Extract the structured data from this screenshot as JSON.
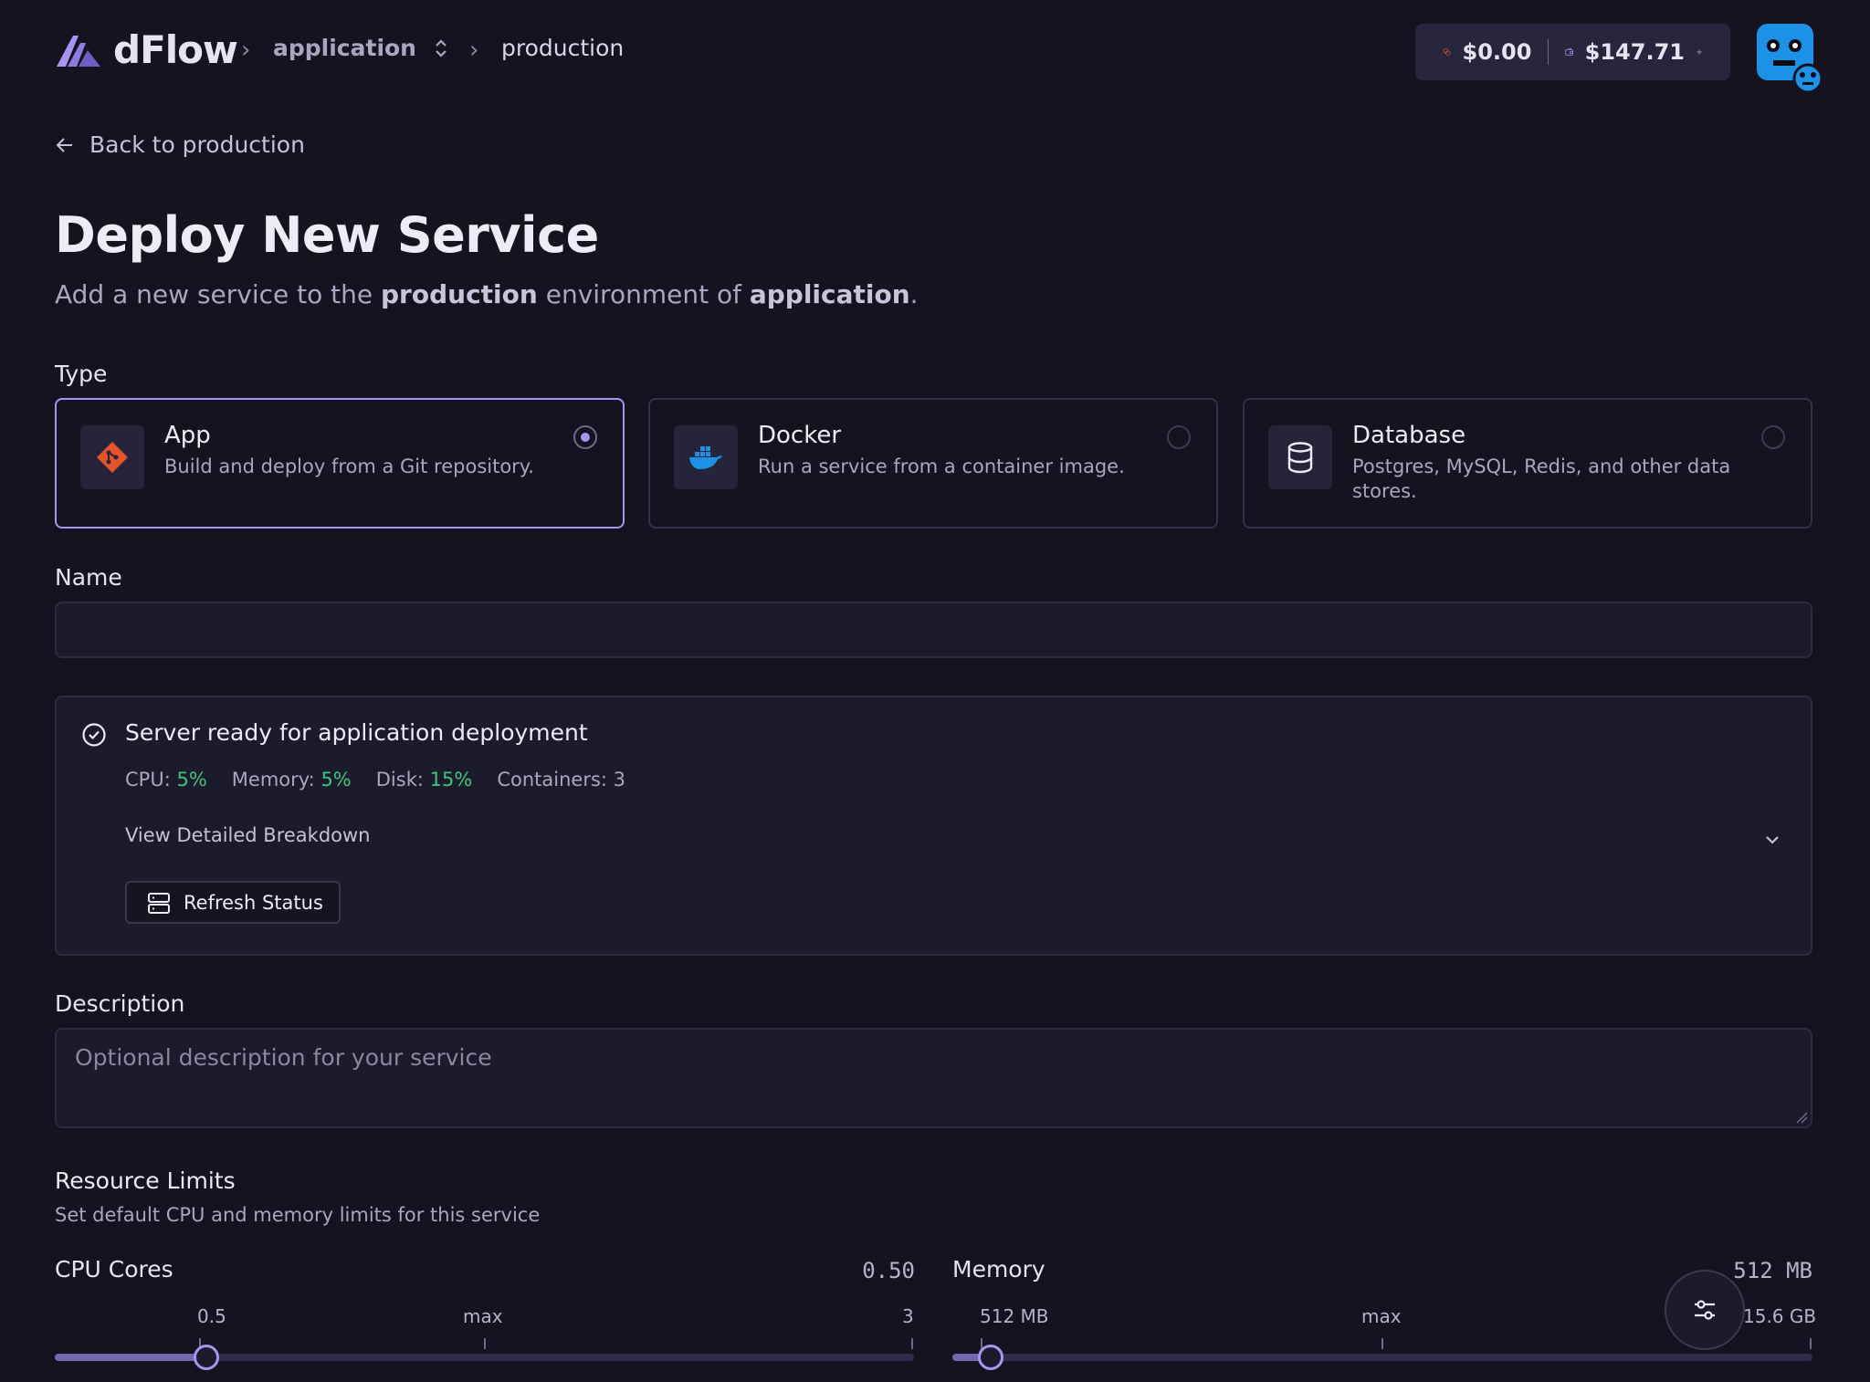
{
  "header": {
    "logo_text": "dFlow",
    "breadcrumb_project": "application",
    "breadcrumb_environment": "production",
    "credits_balance": "$0.00",
    "wallet_balance": "$147.71"
  },
  "back_link": "Back to production",
  "page": {
    "title": "Deploy New Service",
    "subtitle_prefix": "Add a new service to the ",
    "subtitle_env": "production",
    "subtitle_mid": " environment of ",
    "subtitle_project": "application",
    "subtitle_suffix": "."
  },
  "type_section": {
    "label": "Type",
    "selected": "App",
    "options": [
      {
        "name": "App",
        "description": "Build and deploy from a Git repository.",
        "icon": "git-icon"
      },
      {
        "name": "Docker",
        "description": "Run a service from a container image.",
        "icon": "docker-icon"
      },
      {
        "name": "Database",
        "description": "Postgres, MySQL, Redis, and other data stores.",
        "icon": "database-icon"
      }
    ]
  },
  "name_field": {
    "label": "Name",
    "value": ""
  },
  "server_status": {
    "title": "Server ready for application deployment",
    "cpu_label": "CPU:",
    "cpu_value": "5%",
    "memory_label": "Memory:",
    "memory_value": "5%",
    "disk_label": "Disk:",
    "disk_value": "15%",
    "containers_label": "Containers: 3",
    "breakdown_label": "View Detailed Breakdown",
    "refresh_label": "Refresh Status"
  },
  "description_field": {
    "label": "Description",
    "placeholder": "Optional description for your service"
  },
  "resource_limits": {
    "title": "Resource Limits",
    "subtitle": "Set default CPU and memory limits for this service",
    "cpu": {
      "label": "CPU Cores",
      "value": "0.50",
      "tick_min": "0.5",
      "tick_mid": "max",
      "tick_max": "3"
    },
    "memory": {
      "label": "Memory",
      "value": "512 MB",
      "tick_min": "512 MB",
      "tick_mid": "max",
      "tick_max": "15.6 GB"
    }
  },
  "colors": {
    "background": "#14131f",
    "accent": "#a994f2",
    "success": "#3cc67a",
    "git": "#e5532d",
    "docker": "#1d91e6"
  }
}
